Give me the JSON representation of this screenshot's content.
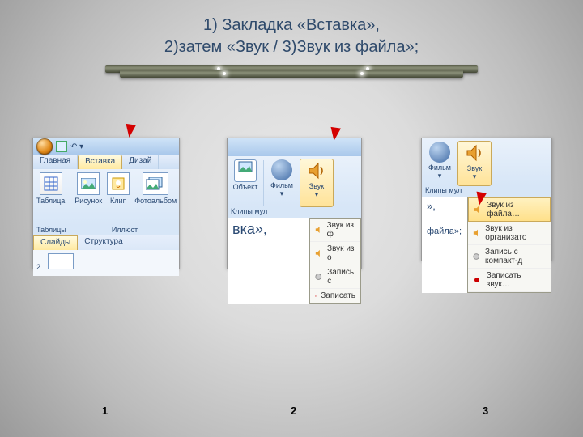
{
  "title_line1": "1) Закладка «Вставка»,",
  "title_line2": "2)затем  «Звук / 3)Звук из файла»;",
  "captions": {
    "c1": "1",
    "c2": "2",
    "c3": "3"
  },
  "shot1": {
    "tabs": {
      "home": "Главная",
      "insert": "Вставка",
      "design": "Дизай"
    },
    "ribbon": {
      "table": "Таблица",
      "picture": "Рисунок",
      "clip": "Клип",
      "album": "Фотоальбом"
    },
    "group_tables": "Таблицы",
    "group_illust": "Иллюст",
    "pane_slides": "Слайды",
    "pane_structure": "Структура",
    "slide_num": "2"
  },
  "shot2": {
    "btn_object": "Объект",
    "btn_movie": "Фильм",
    "btn_sound": "Звук",
    "group": "Клипы мул",
    "menu": {
      "m1": "Звук из ф",
      "m2": "Звук из о",
      "m3": "Запись с",
      "m4": "Записать"
    },
    "doc1": "вка»,"
  },
  "shot3": {
    "btn_movie": "Фильм",
    "btn_sound": "Звук",
    "group": "Клипы мул",
    "menu": {
      "m1": "Звук из файла…",
      "m2": "Звук из организато",
      "m3": "Запись с компакт-д",
      "m4": "Записать звук…"
    },
    "doc1": "»,",
    "doc2": "файла»;"
  }
}
